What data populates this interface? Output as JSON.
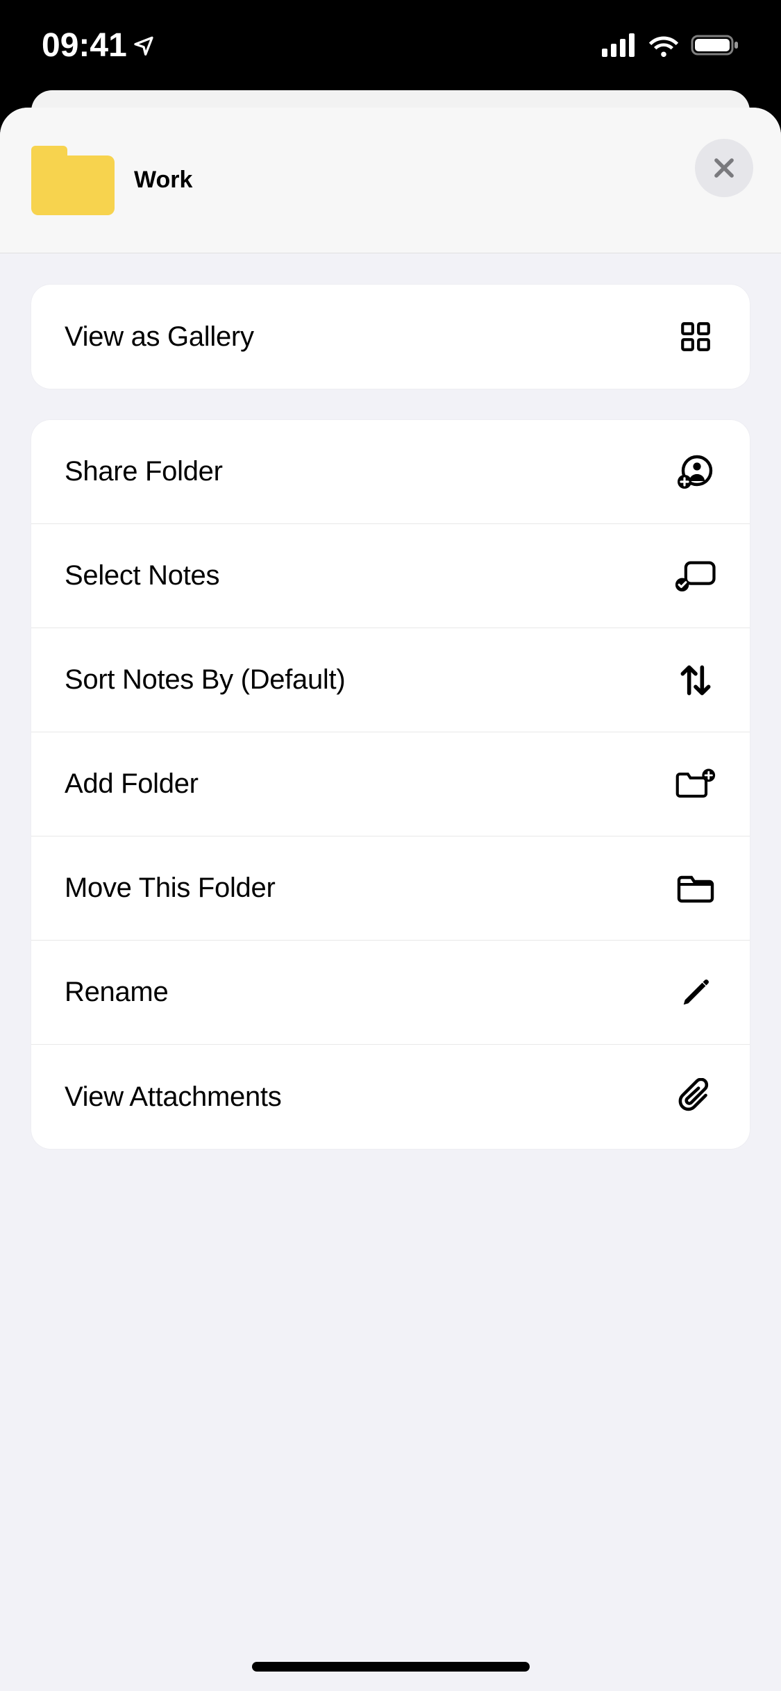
{
  "status": {
    "time": "09:41"
  },
  "header": {
    "folder_name": "Work"
  },
  "group1": {
    "view_gallery": "View as Gallery"
  },
  "group2": {
    "share": "Share Folder",
    "select": "Select Notes",
    "sort": "Sort Notes By (Default)",
    "add": "Add Folder",
    "move": "Move This Folder",
    "rename": "Rename",
    "attachments": "View Attachments"
  }
}
